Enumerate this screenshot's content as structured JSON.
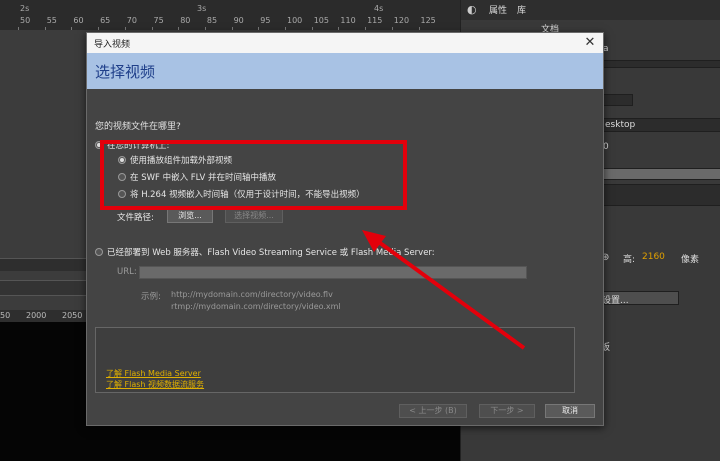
{
  "timeline": {
    "seconds": [
      "2s",
      "3s",
      "4s"
    ],
    "frames": [
      "50",
      "55",
      "60",
      "65",
      "70",
      "75",
      "80",
      "85",
      "90",
      "95",
      "100",
      "105",
      "110",
      "115",
      "120",
      "125"
    ]
  },
  "ruler": {
    "values": [
      "50",
      "2000",
      "2050"
    ]
  },
  "right_panel": {
    "tabs": [
      "属性",
      "库"
    ],
    "doc_label": "文档",
    "partial_a": "a",
    "desktop_text": "esktop",
    "zero_text": "0",
    "height_label": "高:",
    "height_value": "2160",
    "px_label": "像素",
    "settings_text": "设置...",
    "board_text": "板"
  },
  "dialog": {
    "title": "导入视频",
    "close_glyph": "✕",
    "heading": "选择视频",
    "question": "您的视频文件在哪里?",
    "on_computer": "在您的计算机上:",
    "options": [
      "使用播放组件加载外部视频",
      "在 SWF 中嵌入 FLV 并在时间轴中播放",
      "将 H.264 视频嵌入时间轴（仅用于设计时间，不能导出视频）"
    ],
    "file_path_label": "文件路径:",
    "browse_button": "浏览...",
    "select_video_button": "选择视频...",
    "deployed_option": "已经部署到 Web 服务器、Flash Video Streaming Service 或 Flash Media Server:",
    "url_label": "URL:",
    "example_label": "示例:",
    "example_1": "http://mydomain.com/directory/video.flv",
    "example_2": "rtmp://mydomain.com/directory/video.xml",
    "links": [
      "了解 Flash Media Server",
      "了解 Flash 视频数据流服务"
    ],
    "prev_button": "< 上一步 (B)",
    "next_button": "下一步 >",
    "cancel_button": "取消"
  },
  "colors": {
    "highlight_red": "#e3000b",
    "header_blue": "#a8c2e4",
    "link_gold": "#e0b000"
  }
}
